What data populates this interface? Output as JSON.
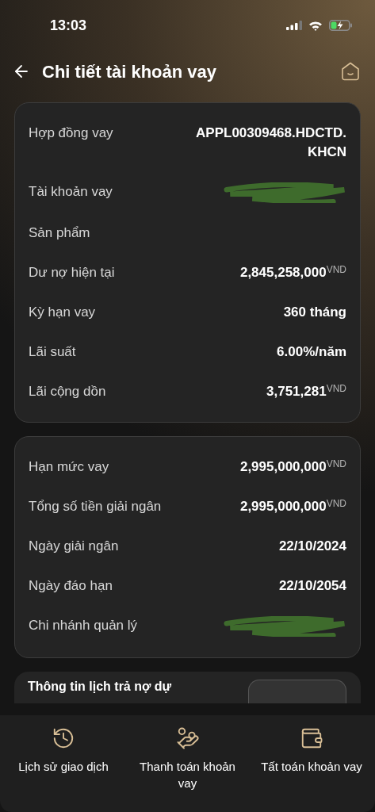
{
  "status_bar": {
    "time": "13:03"
  },
  "header": {
    "title": "Chi tiết tài khoản vay"
  },
  "cards": [
    {
      "rows": [
        {
          "label": "Hợp đồng vay",
          "kind": "text",
          "value": "APPL00309468.HDCTD.KHCN"
        },
        {
          "label": "Tài khoản vay",
          "kind": "redacted"
        },
        {
          "label": "Sản phẩm",
          "kind": "empty"
        },
        {
          "label": "Dư nợ hiện tại",
          "kind": "amount",
          "value": "2,845,258,000",
          "unit": "VND"
        },
        {
          "label": "Kỳ hạn vay",
          "kind": "text",
          "value": "360 tháng"
        },
        {
          "label": "Lãi suất",
          "kind": "text",
          "value": "6.00%/năm"
        },
        {
          "label": "Lãi cộng dồn",
          "kind": "amount",
          "value": "3,751,281",
          "unit": "VND"
        }
      ]
    },
    {
      "rows": [
        {
          "label": "Hạn mức vay",
          "kind": "amount",
          "value": "2,995,000,000",
          "unit": "VND"
        },
        {
          "label": "Tổng số tiền giải ngân",
          "kind": "amount",
          "value": "2,995,000,000",
          "unit": "VND"
        },
        {
          "label": "Ngày giải ngân",
          "kind": "text",
          "value": "22/10/2024"
        },
        {
          "label": "Ngày đáo hạn",
          "kind": "text",
          "value": "22/10/2054"
        },
        {
          "label": "Chi nhánh quản lý",
          "kind": "redacted"
        }
      ]
    }
  ],
  "schedule_card": {
    "title": "Thông tin lịch trả nợ dự"
  },
  "actions": [
    {
      "label": "Lịch sử giao dịch",
      "kind": "history"
    },
    {
      "label": "Thanh toán khoản vay",
      "kind": "pay"
    },
    {
      "label": "Tất toán khoản vay",
      "kind": "settle"
    }
  ]
}
